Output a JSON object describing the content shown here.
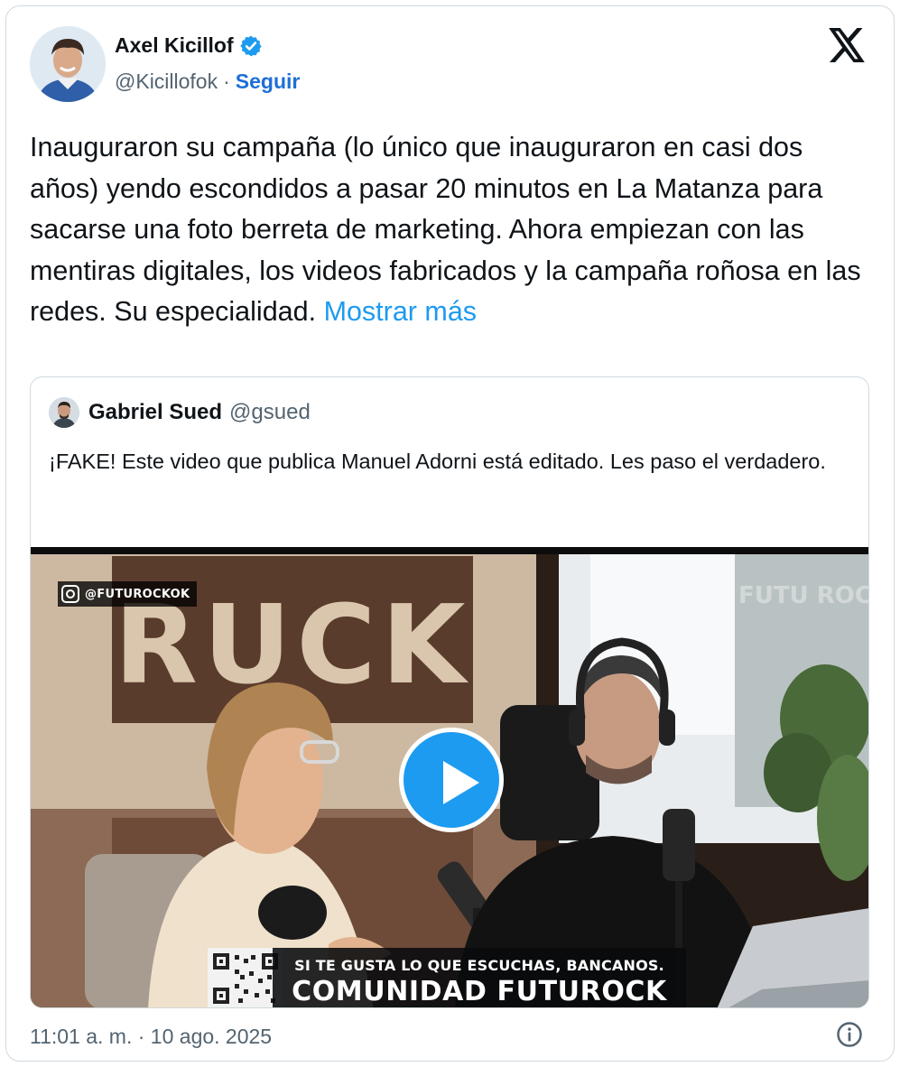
{
  "author": {
    "name": "Axel Kicillof",
    "handle": "@Kicillofok",
    "separator": "·",
    "follow_label": "Seguir"
  },
  "tweet": {
    "text": "Inauguraron su campaña (lo único que inauguraron en casi dos años) yendo escondidos a pasar 20 minutos en La Matanza para sacarse una foto berreta de marketing. Ahora empiezan con las mentiras digitales, los videos fabricados y la campaña roñosa en las redes. Su especialidad.",
    "show_more": "Mostrar más"
  },
  "quote": {
    "name": "Gabriel Sued",
    "handle": "@gsued",
    "text": "¡FAKE! Este video que publica Manuel Adorni está editado. Les paso el verdadero.",
    "video": {
      "sign_text": "RUCK",
      "ig_handle": "@FUTUROCKOK",
      "banner_line1": "SI TE GUSTA LO QUE ESCUCHAS, BANCANOS.",
      "banner_line2": "COMUNIDAD FUTUROCK",
      "watermark": "FUTU ROCK"
    }
  },
  "footer": {
    "timestamp": "11:01 a. m. · 10 ago. 2025"
  },
  "icons": {
    "verified": "verified-badge-icon",
    "logo": "x-logo-icon",
    "play": "play-icon",
    "info": "info-icon",
    "instagram": "instagram-icon"
  },
  "colors": {
    "accent": "#1d9bf0",
    "follow": "#1d6fd6",
    "secondary_text": "#536471",
    "border": "#cfd9de"
  }
}
